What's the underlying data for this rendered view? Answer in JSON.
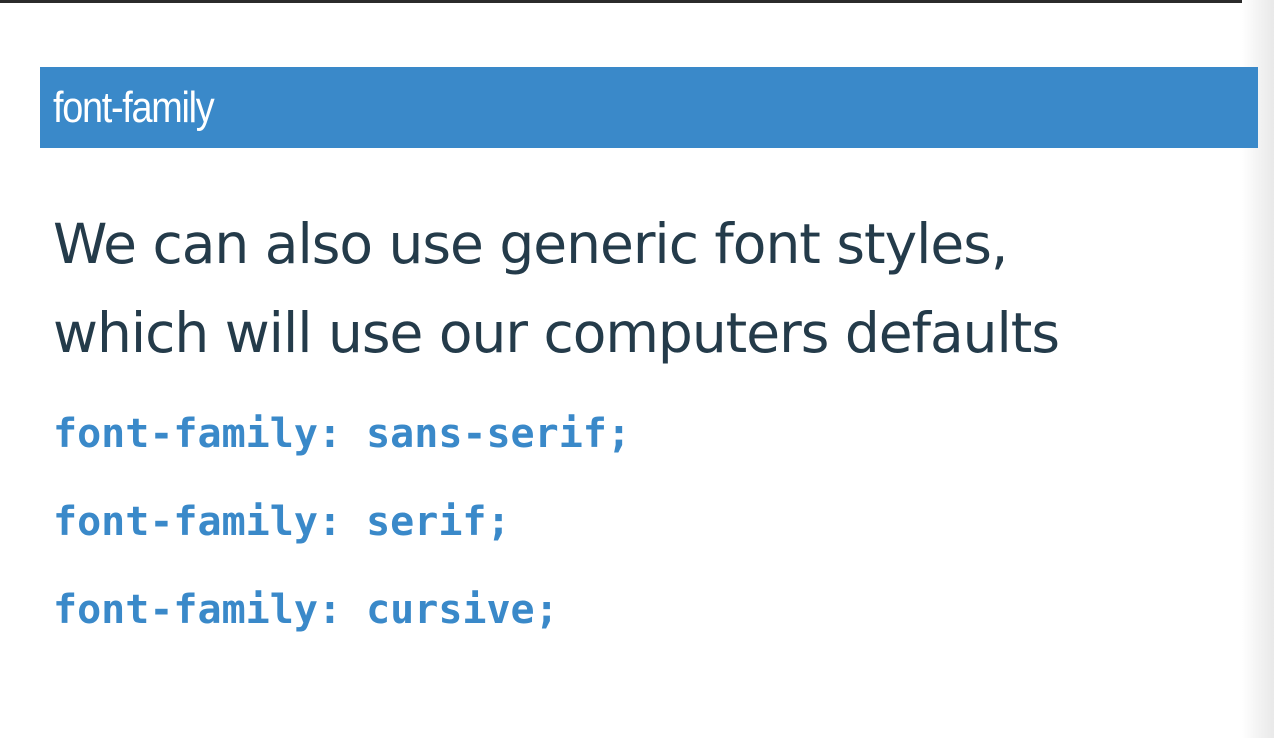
{
  "slide": {
    "title": "font-family",
    "body_lines": [
      "We can also use generic font styles,",
      "which will use our computers defaults"
    ],
    "code_lines": [
      "font-family: sans-serif;",
      "font-family: serif;",
      "font-family: cursive;"
    ]
  },
  "colors": {
    "title_bar": "#3a89c9",
    "title_text": "#ffffff",
    "body_text": "#243b4a",
    "code_text": "#3a89c9"
  }
}
